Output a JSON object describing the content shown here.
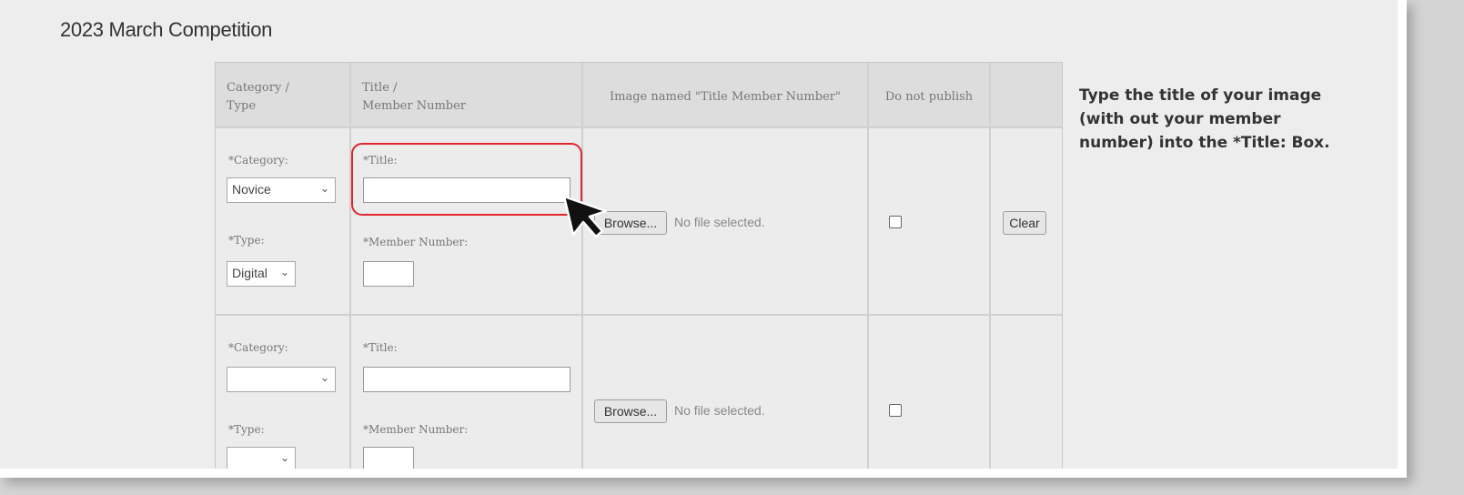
{
  "page": {
    "title": "2023 March Competition"
  },
  "table": {
    "headers": {
      "category_type": [
        "Category /",
        "Type"
      ],
      "title_member": [
        "Title /",
        "Member Number"
      ],
      "image": "Image named \"Title Member Number\"",
      "do_not_publish": "Do not publish"
    },
    "rows": [
      {
        "category_label": "*Category:",
        "category_value": "Novice",
        "type_label": "*Type:",
        "type_value": "Digital",
        "title_label": "*Title:",
        "title_value": "",
        "member_label": "*Member Number:",
        "member_value": "",
        "browse_label": "Browse...",
        "file_status": "No file selected.",
        "do_not_publish_checked": false,
        "clear_label": "Clear"
      },
      {
        "category_label": "*Category:",
        "category_value": "",
        "type_label": "*Type:",
        "type_value": "",
        "title_label": "*Title:",
        "title_value": "",
        "member_label": "*Member Number:",
        "member_value": "",
        "browse_label": "Browse...",
        "file_status": "No file selected.",
        "do_not_publish_checked": false
      }
    ]
  },
  "annotation": {
    "instruction": "Type the title of your image (with out your member number) into the *Title: Box.",
    "highlight_color": "#e0282e"
  },
  "icons": [
    "chevron-down-icon",
    "mouse-cursor-icon"
  ]
}
